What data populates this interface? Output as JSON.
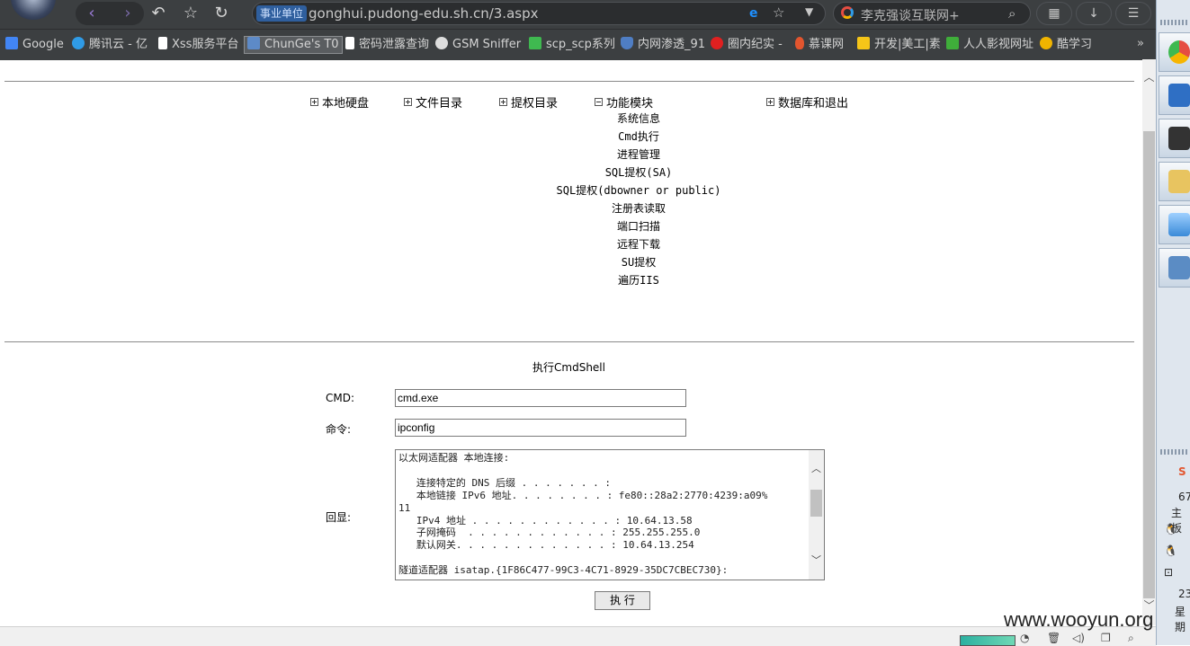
{
  "browser": {
    "address_badge": "事业单位",
    "url": "gonghui.pudong-edu.sh.cn/3.aspx",
    "search_placeholder": "李克强谈互联网+",
    "bookmarks": [
      {
        "label": "Google",
        "color": "#4285f4"
      },
      {
        "label": "腾讯云 - 亿",
        "color": "#2f9be6"
      },
      {
        "label": "Xss服务平台",
        "color": "#ffffff"
      },
      {
        "label": "ChunGe's T0",
        "color": "#5d8ac7",
        "active": true
      },
      {
        "label": "密码泄露查询",
        "color": "#ffffff"
      },
      {
        "label": "GSM Sniffer",
        "color": "#ffffff"
      },
      {
        "label": "scp_scp系列",
        "color": "#3fb950"
      },
      {
        "label": "内网渗透_91",
        "color": "#4f7ec4"
      },
      {
        "label": "圈内纪实 -",
        "color": "#e02020"
      },
      {
        "label": "慕课网",
        "color": "#e2552e"
      },
      {
        "label": "开发|美工|素",
        "color": "#f5c518"
      },
      {
        "label": "人人影视网址",
        "color": "#3fae3a"
      },
      {
        "label": "酷学习",
        "color": "#f0b400"
      }
    ],
    "bookmarks_more": "»"
  },
  "menu": {
    "items": [
      {
        "label": "本地硬盘",
        "expanded": false
      },
      {
        "label": "文件目录",
        "expanded": false
      },
      {
        "label": "提权目录",
        "expanded": false
      },
      {
        "label": "功能模块",
        "expanded": true
      },
      {
        "label": "数据库和退出",
        "expanded": false
      }
    ],
    "submenu": [
      "系统信息",
      "Cmd执行",
      "进程管理",
      "SQL提权(SA)",
      "SQL提权(dbowner or public)",
      "注册表读取",
      "端口扫描",
      "远程下载",
      "SU提权",
      "遍历IIS"
    ]
  },
  "form": {
    "title": "执行CmdShell",
    "cmd_label": "CMD:",
    "cmd_value": "cmd.exe",
    "command_label": "命令:",
    "command_value": "ipconfig",
    "output_label": "回显:",
    "output_text": "以太网适配器 本地连接:\n\n   连接特定的 DNS 后缀 . . . . . . . :\n   本地链接 IPv6 地址. . . . . . . . : fe80::28a2:2770:4239:a09%\n11\n   IPv4 地址 . . . . . . . . . . . . : 10.64.13.58\n   子网掩码  . . . . . . . . . . . . : 255.255.255.0\n   默认网关. . . . . . . . . . . . . : 10.64.13.254\n\n隧道适配器 isatap.{1F86C477-99C3-4C71-8929-35DC7CBEC730}:",
    "exec_label": "执 行"
  },
  "sidepanel": {
    "text1": "67",
    "text2": "主板",
    "text3": "23",
    "text4": "星期"
  },
  "watermark": "www.wooyun.org"
}
